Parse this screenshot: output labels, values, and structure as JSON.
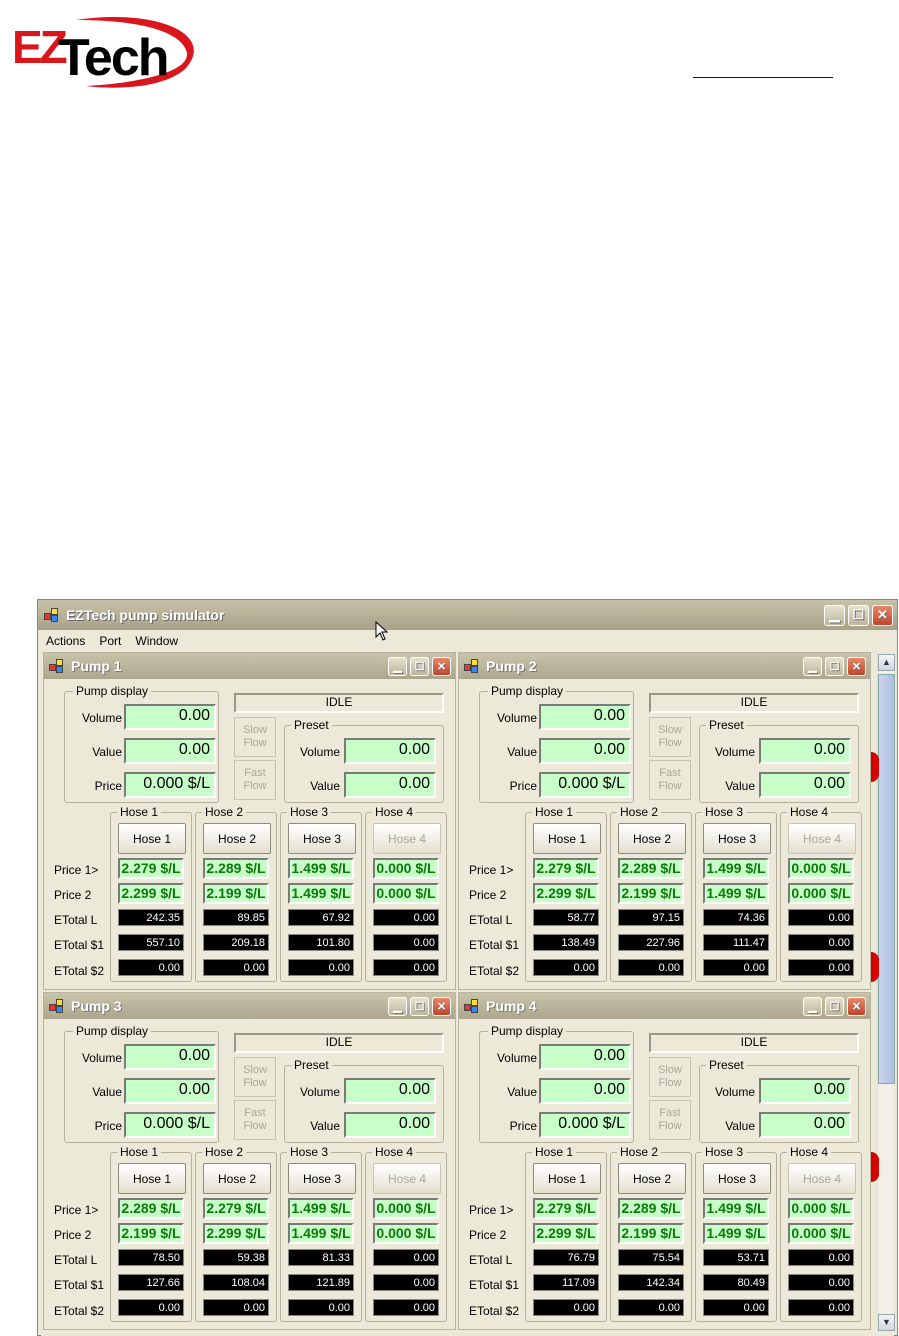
{
  "logo": {
    "ez": "EZ",
    "tech": "Tech"
  },
  "app": {
    "title": "EZTech pump simulator",
    "menu": [
      "Actions",
      "Port",
      "Window"
    ]
  },
  "labels": {
    "pump_display": "Pump display",
    "volume": "Volume",
    "value": "Value",
    "price": "Price",
    "preset": "Preset",
    "slow_flow": "Slow Flow",
    "fast_flow": "Fast Flow",
    "price1": "Price 1>",
    "price2": "Price 2",
    "etotal_l": "ETotal  L",
    "etotal_1": "ETotal $1",
    "etotal_2": "ETotal $2"
  },
  "pumps": [
    {
      "title": "Pump 1",
      "status": "IDLE",
      "volume": "0.00",
      "value": "0.00",
      "price": "0.000 $/L",
      "preset_volume": "0.00",
      "preset_value": "0.00",
      "hoses": [
        {
          "group": "Hose 1",
          "button": "Hose 1",
          "enabled": true,
          "price1": "2.279 $/L",
          "price2": "2.299 $/L",
          "etotal_l": "242.35",
          "etotal_1": "557.10",
          "etotal_2": "0.00"
        },
        {
          "group": "Hose 2",
          "button": "Hose 2",
          "enabled": true,
          "price1": "2.289 $/L",
          "price2": "2.199 $/L",
          "etotal_l": "89.85",
          "etotal_1": "209.18",
          "etotal_2": "0.00"
        },
        {
          "group": "Hose 3",
          "button": "Hose 3",
          "enabled": true,
          "price1": "1.499 $/L",
          "price2": "1.499 $/L",
          "etotal_l": "67.92",
          "etotal_1": "101.80",
          "etotal_2": "0.00"
        },
        {
          "group": "Hose 4",
          "button": "Hose 4",
          "enabled": false,
          "price1": "0.000 $/L",
          "price2": "0.000 $/L",
          "etotal_l": "0.00",
          "etotal_1": "0.00",
          "etotal_2": "0.00"
        }
      ]
    },
    {
      "title": "Pump 2",
      "status": "IDLE",
      "volume": "0.00",
      "value": "0.00",
      "price": "0.000 $/L",
      "preset_volume": "0.00",
      "preset_value": "0.00",
      "hoses": [
        {
          "group": "Hose 1",
          "button": "Hose 1",
          "enabled": true,
          "price1": "2.279 $/L",
          "price2": "2.299 $/L",
          "etotal_l": "58.77",
          "etotal_1": "138.49",
          "etotal_2": "0.00"
        },
        {
          "group": "Hose 2",
          "button": "Hose 2",
          "enabled": true,
          "price1": "2.289 $/L",
          "price2": "2.199 $/L",
          "etotal_l": "97.15",
          "etotal_1": "227.96",
          "etotal_2": "0.00"
        },
        {
          "group": "Hose 3",
          "button": "Hose 3",
          "enabled": true,
          "price1": "1.499 $/L",
          "price2": "1.499 $/L",
          "etotal_l": "74.36",
          "etotal_1": "111.47",
          "etotal_2": "0.00"
        },
        {
          "group": "Hose 4",
          "button": "Hose 4",
          "enabled": false,
          "price1": "0.000 $/L",
          "price2": "0.000 $/L",
          "etotal_l": "0.00",
          "etotal_1": "0.00",
          "etotal_2": "0.00"
        }
      ]
    },
    {
      "title": "Pump 3",
      "status": "IDLE",
      "volume": "0.00",
      "value": "0.00",
      "price": "0.000 $/L",
      "preset_volume": "0.00",
      "preset_value": "0.00",
      "hoses": [
        {
          "group": "Hose 1",
          "button": "Hose 1",
          "enabled": true,
          "price1": "2.289 $/L",
          "price2": "2.199 $/L",
          "etotal_l": "78.50",
          "etotal_1": "127.66",
          "etotal_2": "0.00"
        },
        {
          "group": "Hose 2",
          "button": "Hose 2",
          "enabled": true,
          "price1": "2.279 $/L",
          "price2": "2.299 $/L",
          "etotal_l": "59.38",
          "etotal_1": "108.04",
          "etotal_2": "0.00"
        },
        {
          "group": "Hose 3",
          "button": "Hose 3",
          "enabled": true,
          "price1": "1.499 $/L",
          "price2": "1.499 $/L",
          "etotal_l": "81.33",
          "etotal_1": "121.89",
          "etotal_2": "0.00"
        },
        {
          "group": "Hose 4",
          "button": "Hose 4",
          "enabled": false,
          "price1": "0.000 $/L",
          "price2": "0.000 $/L",
          "etotal_l": "0.00",
          "etotal_1": "0.00",
          "etotal_2": "0.00"
        }
      ]
    },
    {
      "title": "Pump 4",
      "status": "IDLE",
      "volume": "0.00",
      "value": "0.00",
      "price": "0.000 $/L",
      "preset_volume": "0.00",
      "preset_value": "0.00",
      "hoses": [
        {
          "group": "Hose 1",
          "button": "Hose 1",
          "enabled": true,
          "price1": "2.279 $/L",
          "price2": "2.299 $/L",
          "etotal_l": "76.79",
          "etotal_1": "117.09",
          "etotal_2": "0.00"
        },
        {
          "group": "Hose 2",
          "button": "Hose 2",
          "enabled": true,
          "price1": "2.289 $/L",
          "price2": "2.199 $/L",
          "etotal_l": "75.54",
          "etotal_1": "142.34",
          "etotal_2": "0.00"
        },
        {
          "group": "Hose 3",
          "button": "Hose 3",
          "enabled": true,
          "price1": "1.499 $/L",
          "price2": "1.499 $/L",
          "etotal_l": "53.71",
          "etotal_1": "80.49",
          "etotal_2": "0.00"
        },
        {
          "group": "Hose 4",
          "button": "Hose 4",
          "enabled": false,
          "price1": "0.000 $/L",
          "price2": "0.000 $/L",
          "etotal_l": "0.00",
          "etotal_1": "0.00",
          "etotal_2": "0.00"
        }
      ]
    }
  ],
  "colors": {
    "lcd_bg": "#c8ffc8",
    "price_text": "#0b7a0b",
    "logo_red": "#d9161b"
  },
  "icons": {
    "minimize": "minimize-icon",
    "maximize": "maximize-icon",
    "close": "close-icon",
    "app": "app-icon",
    "cursor": "mouse-cursor-icon"
  }
}
